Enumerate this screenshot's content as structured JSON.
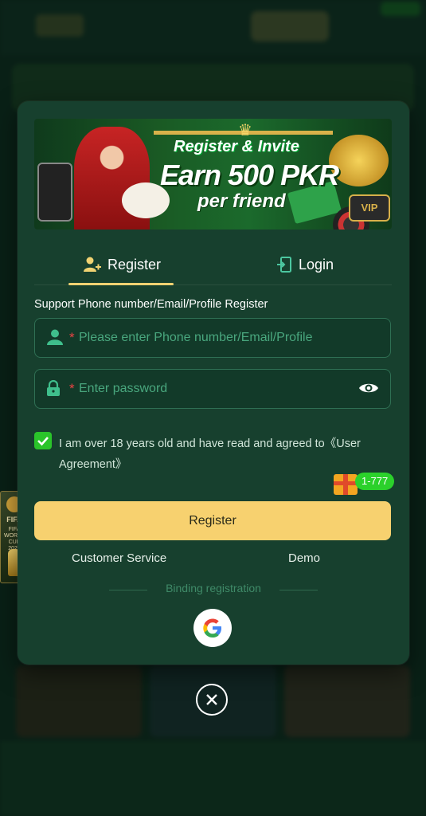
{
  "banner": {
    "line1": "Register & Invite",
    "line2": "Earn 500 PKR",
    "line3": "per friend",
    "vip": "VIP"
  },
  "tabs": [
    {
      "label": "Register",
      "icon": "user-plus-icon",
      "active": true
    },
    {
      "label": "Login",
      "icon": "door-enter-icon",
      "active": false
    }
  ],
  "form": {
    "support_text": "Support Phone number/Email/Profile Register",
    "phone_placeholder": "Please enter Phone number/Email/Profile",
    "password_placeholder": "Enter password",
    "required_mark": "*",
    "agreement_text": "I am over 18 years old and have read and agreed to",
    "agreement_link": "《User Agreement》",
    "agreement_checked": true,
    "register_label": "Register"
  },
  "promo_badge": "1-777",
  "links": {
    "customer_service": "Customer Service",
    "demo": "Demo"
  },
  "binding_label": "Binding registration",
  "side_widget": {
    "line1": "FIFA",
    "line2": "FIFA WORLD CUP 2026"
  },
  "colors": {
    "accent": "#f7d16f",
    "modal_bg": "#17402e",
    "field_border": "#2f7054",
    "placeholder": "#49a77e",
    "check_green": "#2ac42a",
    "required_red": "#e94343"
  }
}
